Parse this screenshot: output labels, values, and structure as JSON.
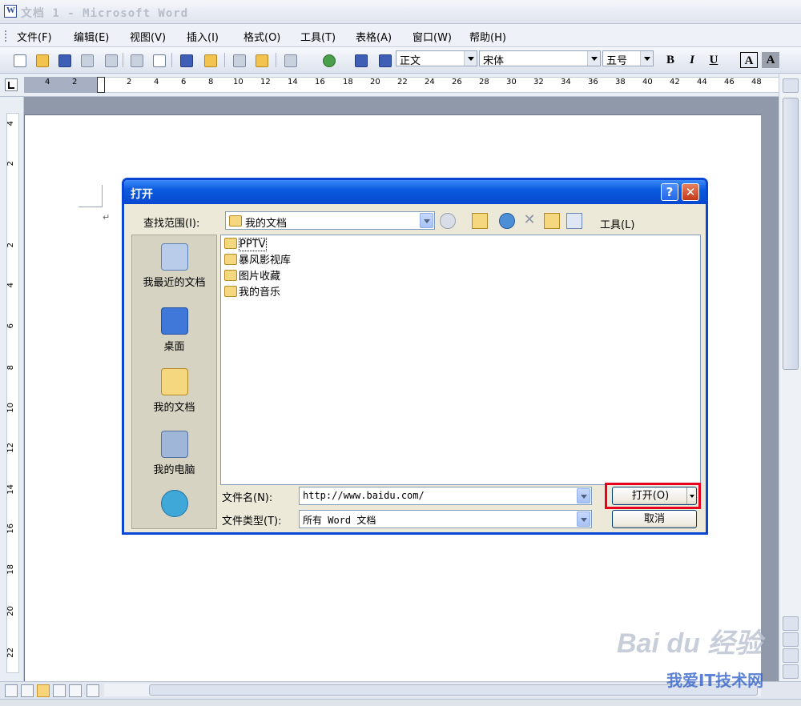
{
  "window": {
    "title": "文档 1 - Microsoft Word"
  },
  "menu": [
    "文件(F)",
    "编辑(E)",
    "视图(V)",
    "插入(I)",
    "格式(O)",
    "工具(T)",
    "表格(A)",
    "窗口(W)",
    "帮助(H)"
  ],
  "toolbar": {
    "style": "正文",
    "font": "宋体",
    "size": "五号",
    "bold": "B",
    "italic": "I",
    "underline": "U",
    "char_border": "A",
    "char_shade": "A"
  },
  "ruler": {
    "h_ticks": [
      "4",
      "2",
      "2",
      "4",
      "6",
      "8",
      "10",
      "12",
      "14",
      "16",
      "18",
      "20",
      "22",
      "24",
      "26",
      "28",
      "30",
      "32",
      "34",
      "36",
      "38",
      "40",
      "42",
      "44",
      "46",
      "48"
    ],
    "v_ticks": [
      "4",
      "2",
      "2",
      "4",
      "6",
      "8",
      "10",
      "12",
      "14",
      "16",
      "18",
      "20",
      "22"
    ]
  },
  "document": {
    "paragraph_mark": "↵"
  },
  "dialog": {
    "title": "打开",
    "help": "?",
    "close": "✕",
    "lookin_label": "查找范围(I):",
    "lookin_value": "我的文档",
    "tools_label": "工具(L)",
    "places": [
      "我最近的文档",
      "桌面",
      "我的文档",
      "我的电脑"
    ],
    "files": [
      "PPTV",
      "暴风影视库",
      "图片收藏",
      "我的音乐"
    ],
    "filename_label": "文件名(N):",
    "filename_value": "http://www.baidu.com/",
    "filetype_label": "文件类型(T):",
    "filetype_value": "所有 Word 文档",
    "open_button": "打开(O)",
    "cancel_button": "取消"
  },
  "watermark": {
    "brand": "Bai du 经验",
    "sub": "我爱IT技术网"
  },
  "colors": {
    "dialog_border": "#0a46d5",
    "highlight": "#e8001c"
  }
}
